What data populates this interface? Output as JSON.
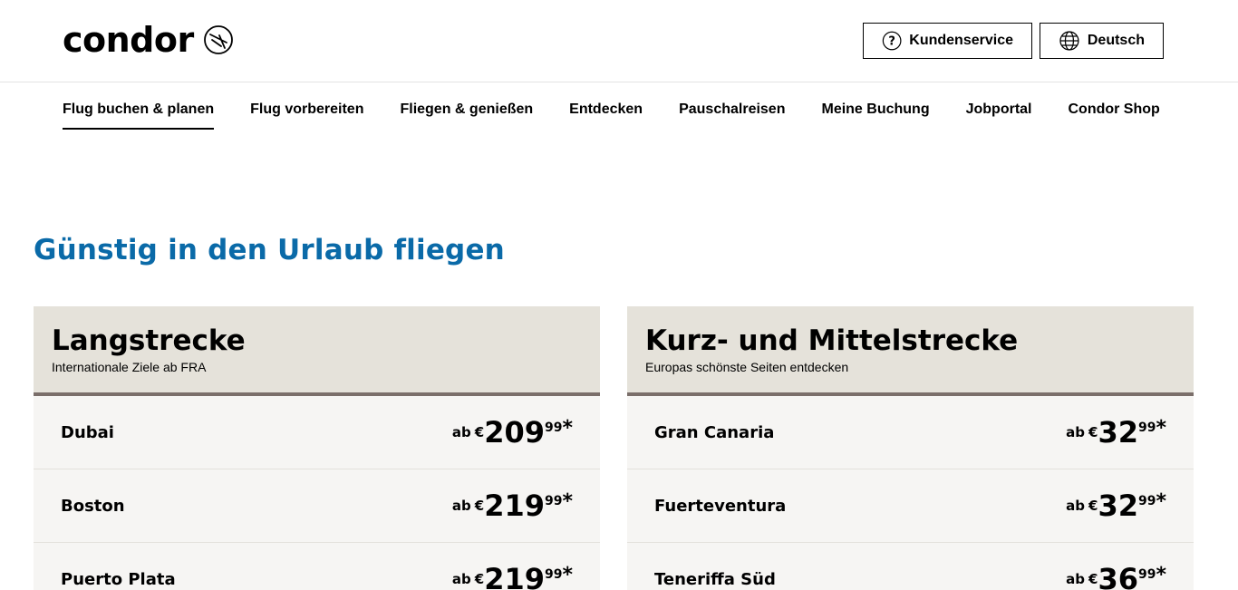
{
  "header": {
    "logo_text": "condor",
    "service_label": "Kundenservice",
    "language_label": "Deutsch"
  },
  "nav": {
    "items": [
      {
        "label": "Flug buchen & planen",
        "active": true
      },
      {
        "label": "Flug vorbereiten"
      },
      {
        "label": "Fliegen & genießen"
      },
      {
        "label": "Entdecken"
      },
      {
        "label": "Pauschalreisen"
      },
      {
        "label": "Meine Buchung"
      },
      {
        "label": "Jobportal"
      },
      {
        "label": "Condor Shop"
      }
    ]
  },
  "headline": "Günstig in den Urlaub fliegen",
  "cards": [
    {
      "title": "Langstrecke",
      "subtitle": "Internationale Ziele ab FRA",
      "rows": [
        {
          "destination": "Dubai",
          "prefix": "ab",
          "currency": "€",
          "amount": "209",
          "cents": "99",
          "asterisk": "*"
        },
        {
          "destination": "Boston",
          "prefix": "ab",
          "currency": "€",
          "amount": "219",
          "cents": "99",
          "asterisk": "*"
        },
        {
          "destination": "Puerto Plata",
          "prefix": "ab",
          "currency": "€",
          "amount": "219",
          "cents": "99",
          "asterisk": "*"
        }
      ]
    },
    {
      "title": "Kurz- und Mittelstrecke",
      "subtitle": "Europas schönste Seiten entdecken",
      "rows": [
        {
          "destination": "Gran Canaria",
          "prefix": "ab",
          "currency": "€",
          "amount": "32",
          "cents": "99",
          "asterisk": "*"
        },
        {
          "destination": "Fuerteventura",
          "prefix": "ab",
          "currency": "€",
          "amount": "32",
          "cents": "99",
          "asterisk": "*"
        },
        {
          "destination": "Teneriffa Süd",
          "prefix": "ab",
          "currency": "€",
          "amount": "36",
          "cents": "99",
          "asterisk": "*"
        }
      ]
    }
  ],
  "colors": {
    "headline": "#0a6aa8",
    "card_head_bg": "#e5e2da",
    "card_rule": "#7a6e6a",
    "card_body_bg": "#f6f5f3"
  },
  "icons": {
    "logo": "condor-bird-icon",
    "service": "question-circle-icon",
    "language": "globe-icon"
  }
}
